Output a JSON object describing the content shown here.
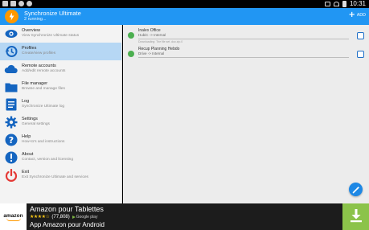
{
  "status_bar": {
    "time": "10:31"
  },
  "app_bar": {
    "title": "Synchronize Ultimate",
    "subtitle": "2 running...",
    "add_label": "ADD"
  },
  "drawer": {
    "items": [
      {
        "title": "Overview",
        "desc": "View Synchronize Ultimate status",
        "icon": "eye-icon",
        "active": false
      },
      {
        "title": "Profiles",
        "desc": "Create/view profiles",
        "icon": "history-icon",
        "active": true
      },
      {
        "title": "Remote accounts",
        "desc": "Add/edit remote accounts",
        "icon": "cloud-icon",
        "active": false
      },
      {
        "title": "File manager",
        "desc": "Browse and manage files",
        "icon": "folder-icon",
        "active": false
      },
      {
        "title": "Log",
        "desc": "Synchronize Ultimate log",
        "icon": "log-icon",
        "active": false
      },
      {
        "title": "Settings",
        "desc": "General settings",
        "icon": "gear-icon",
        "active": false
      },
      {
        "title": "Help",
        "desc": "How-to's and instructions",
        "icon": "help-icon",
        "active": false
      },
      {
        "title": "About",
        "desc": "Contact, version and licensing",
        "icon": "info-icon",
        "active": false
      },
      {
        "title": "Exit",
        "desc": "Exit Synchronize Ultimate and services",
        "icon": "power-icon",
        "active": false
      }
    ]
  },
  "tasks": [
    {
      "name": "Inalex Office",
      "route": "HubiC -> Internal",
      "note": "Downloading: The file set .doc.zip.0"
    },
    {
      "name": "Recup Planning Hebdo",
      "route": "Drive -> Internal",
      "note": ""
    }
  ],
  "ad": {
    "logo_text": "amazon",
    "title": "Amazon pour Tablettes",
    "stars": "★★★★☆",
    "rating_count": "(77,808)",
    "store": "Google play",
    "subtitle": "App Amazon pour Android"
  },
  "colors": {
    "primary": "#2196f3",
    "accent": "#ff9800",
    "running": "#4caf50",
    "download": "#8bc34a"
  }
}
